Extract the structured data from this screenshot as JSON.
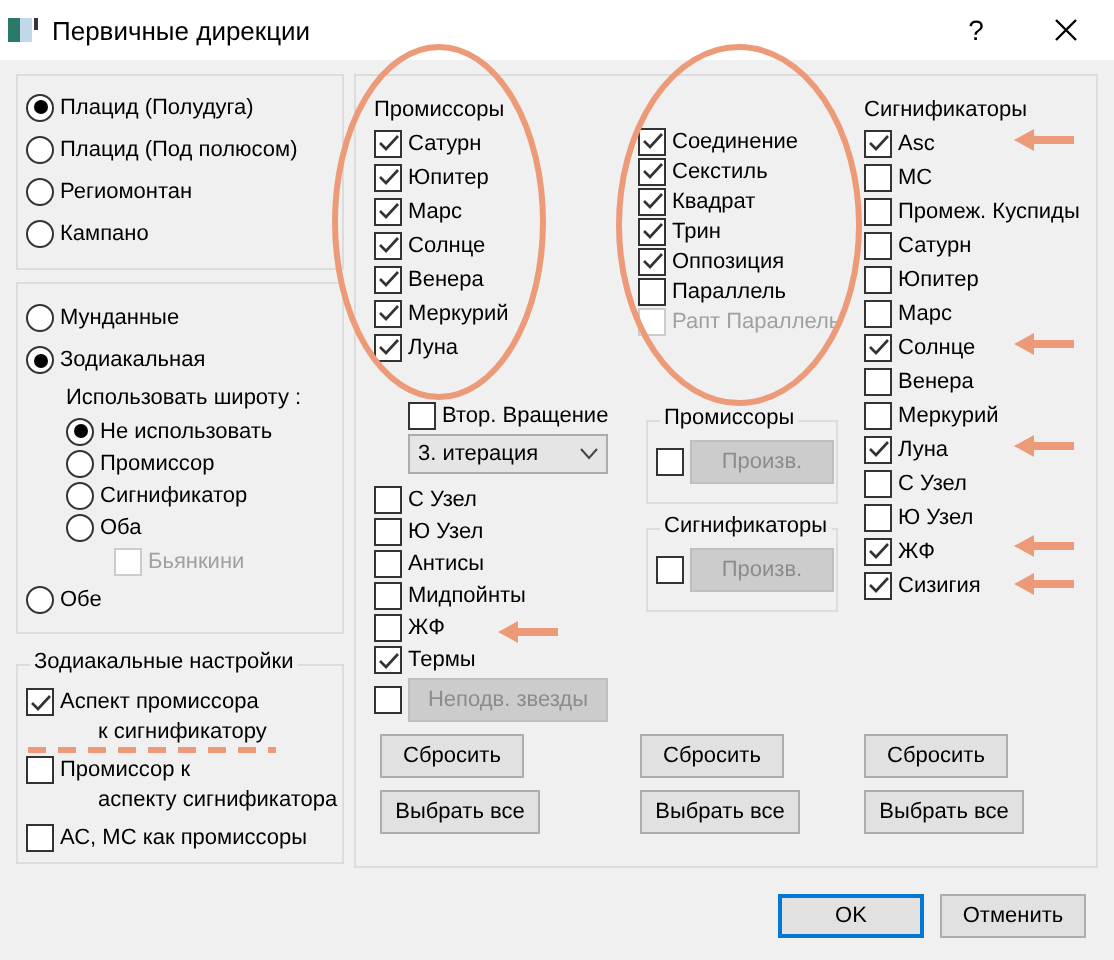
{
  "window": {
    "title": "Первичные дирекции",
    "help": "?"
  },
  "methods": [
    {
      "label": "Плацид (Полудуга)",
      "selected": true
    },
    {
      "label": "Плацид (Под полюсом)",
      "selected": false
    },
    {
      "label": "Региомонтан",
      "selected": false
    },
    {
      "label": "Кампано",
      "selected": false
    }
  ],
  "coordinates": {
    "options": [
      {
        "label": "Мунданные",
        "selected": false
      },
      {
        "label": "Зодиакальная",
        "selected": true
      }
    ],
    "latitude_label": "Использовать широту :",
    "latitude_options": [
      {
        "label": "Не использовать",
        "selected": true
      },
      {
        "label": "Промиссор",
        "selected": false
      },
      {
        "label": "Сигнификатор",
        "selected": false
      },
      {
        "label": "Оба",
        "selected": false
      }
    ],
    "bianchini": {
      "label": "Бьянкини",
      "checked": false,
      "disabled": true
    },
    "both": {
      "label": "Обе",
      "selected": false
    }
  },
  "zodiacal_settings": {
    "title": "Зодиакальные настройки",
    "items": [
      {
        "lines": [
          "Аспект промиссора",
          "к сигнификатору"
        ],
        "checked": true
      },
      {
        "lines": [
          "Промиссор к",
          "аспекту сигнификатора"
        ],
        "checked": false
      },
      {
        "lines": [
          "АС, МС как промиссоры"
        ],
        "checked": false
      }
    ]
  },
  "promissors": {
    "title": "Промиссоры",
    "items": [
      {
        "label": "Сатурн",
        "checked": true
      },
      {
        "label": "Юпитер",
        "checked": true
      },
      {
        "label": "Марс",
        "checked": true
      },
      {
        "label": "Солнце",
        "checked": true
      },
      {
        "label": "Венера",
        "checked": true
      },
      {
        "label": "Меркурий",
        "checked": true
      },
      {
        "label": "Луна",
        "checked": true
      }
    ],
    "second_rotation": {
      "label": "Втор. Вращение",
      "checked": false
    },
    "iteration": {
      "value": "3. итерация"
    },
    "extra": [
      {
        "label": "С Узел",
        "checked": false
      },
      {
        "label": "Ю Узел",
        "checked": false
      },
      {
        "label": "Антисы",
        "checked": false
      },
      {
        "label": "Мидпойнты",
        "checked": false
      },
      {
        "label": "ЖФ",
        "checked": false
      },
      {
        "label": "Термы",
        "checked": true
      }
    ],
    "fixed_stars": {
      "checked": false,
      "button": "Неподв. звезды",
      "disabled": true
    },
    "reset": "Сбросить",
    "select_all": "Выбрать все"
  },
  "aspects": {
    "items": [
      {
        "label": "Соединение",
        "checked": true,
        "disabled": false
      },
      {
        "label": "Секстиль",
        "checked": true,
        "disabled": false
      },
      {
        "label": "Квадрат",
        "checked": true,
        "disabled": false
      },
      {
        "label": "Трин",
        "checked": true,
        "disabled": false
      },
      {
        "label": "Оппозиция",
        "checked": true,
        "disabled": false
      },
      {
        "label": "Параллель",
        "checked": false,
        "disabled": false
      },
      {
        "label": "Рапт Параллель",
        "checked": false,
        "disabled": true
      }
    ],
    "groups": [
      {
        "title": "Промиссоры",
        "checked": false,
        "button": "Произв.",
        "disabled": true
      },
      {
        "title": "Сигнификаторы",
        "checked": false,
        "button": "Произв.",
        "disabled": true
      }
    ],
    "reset": "Сбросить",
    "select_all": "Выбрать все"
  },
  "significators": {
    "title": "Сигнификаторы",
    "items": [
      {
        "label": "Asc",
        "checked": true
      },
      {
        "label": "MC",
        "checked": false
      },
      {
        "label": "Промеж. Куспиды",
        "checked": false
      },
      {
        "label": "Сатурн",
        "checked": false
      },
      {
        "label": "Юпитер",
        "checked": false
      },
      {
        "label": "Марс",
        "checked": false
      },
      {
        "label": "Солнце",
        "checked": true
      },
      {
        "label": "Венера",
        "checked": false
      },
      {
        "label": "Меркурий",
        "checked": false
      },
      {
        "label": "Луна",
        "checked": true
      },
      {
        "label": "С Узел",
        "checked": false
      },
      {
        "label": "Ю Узел",
        "checked": false
      },
      {
        "label": "ЖФ",
        "checked": true
      },
      {
        "label": "Сизигия",
        "checked": true
      }
    ],
    "reset": "Сбросить",
    "select_all": "Выбрать все"
  },
  "buttons": {
    "ok": "OK",
    "cancel": "Отменить"
  }
}
